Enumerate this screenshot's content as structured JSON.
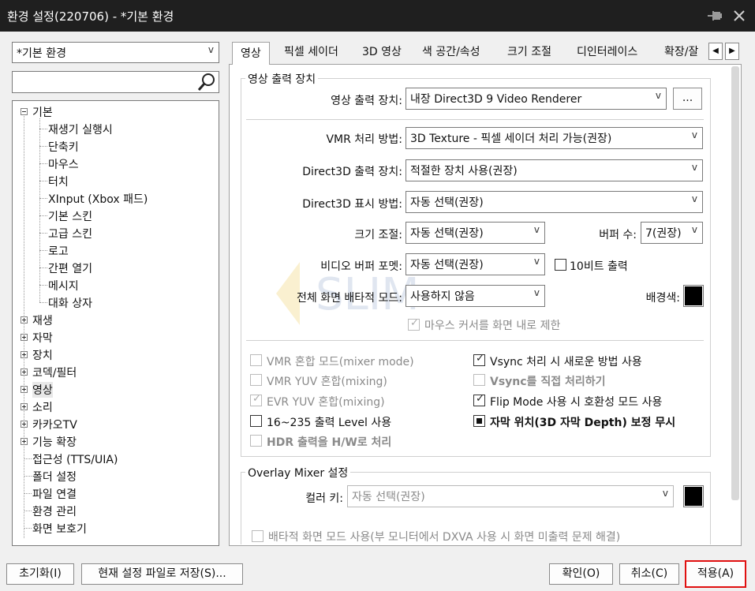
{
  "window": {
    "title": "환경 설정(220706) - *기본 환경"
  },
  "profile": {
    "selected": "*기본 환경"
  },
  "search": {
    "value": ""
  },
  "tree": {
    "expanded": {
      "label": "기본",
      "children": [
        "재생기 실행시",
        "단축키",
        "마우스",
        "터치",
        "XInput (Xbox 패드)",
        "기본 스킨",
        "고급 스킨",
        "로고",
        "간편 열기",
        "메시지",
        "대화 상자"
      ]
    },
    "collapsed": [
      "재생",
      "자막",
      "장치",
      "코덱/필터",
      "영상",
      "소리",
      "카카오TV",
      "기능 확장"
    ],
    "leaves": [
      "접근성 (TTS/UIA)",
      "폴더 설정",
      "파일 연결",
      "환경 관리",
      "화면 보호기"
    ]
  },
  "tabs": [
    "영상",
    "픽셀 세이더",
    "3D 영상",
    "색 공간/속성",
    "크기 조절",
    "디인터레이스",
    "확장/잘"
  ],
  "output_group": {
    "title": "영상 출력 장치",
    "device_label": "영상 출력 장치:",
    "device_value": "내장 Direct3D 9 Video Renderer",
    "browse_label": "...",
    "vmr_label": "VMR 처리 방법:",
    "vmr_value": "3D Texture - 픽셀 세이더 처리 가능(권장)",
    "d3d_device_label": "Direct3D 출력 장치:",
    "d3d_device_value": "적절한 장치 사용(권장)",
    "d3d_display_label": "Direct3D 표시 방법:",
    "d3d_display_value": "자동 선택(권장)",
    "size_label": "크기 조절:",
    "size_value": "자동 선택(권장)",
    "buffer_label": "버퍼 수:",
    "buffer_value": "7(권장)",
    "vbuf_label": "비디오 버퍼 포멧:",
    "vbuf_value": "자동 선택(권장)",
    "tenbit_label": "10비트 출력",
    "fullscreen_label": "전체 화면 배타적 모드:",
    "fullscreen_value": "사용하지 않음",
    "bgcolor_label": "배경색:",
    "mouse_limit_label": "마우스 커서를 화면 내로 제한"
  },
  "options": {
    "vmr_mixer": "VMR 혼합 모드(mixer mode)",
    "vmr_yuv": "VMR YUV 혼합(mixing)",
    "evr_yuv": "EVR YUV 혼합(mixing)",
    "level": "16~235 출력 Level 사용",
    "hdr": "HDR 출력을 H/W로 처리",
    "vsync_new": "Vsync 처리 시 새로운 방법 사용",
    "vsync_direct": "Vsync를 직접 처리하기",
    "flip": "Flip Mode 사용 시 호환성 모드 사용",
    "depth": "자막 위치(3D 자막 Depth) 보정 무시"
  },
  "overlay_group": {
    "title": "Overlay Mixer 설정",
    "color_key_label": "컬러 키:",
    "color_key_value": "자동 선택(권장)",
    "exclusive_label": "배타적 화면 모드 사용(부 모니터에서 DXVA 사용 시 화면 미출력 문제 해결)"
  },
  "footer": {
    "reset": "초기화(I)",
    "save_as": "현재 설정 파일로 저장(S)...",
    "ok": "확인(O)",
    "cancel": "취소(C)",
    "apply": "적용(A)"
  },
  "colors": {
    "titlebar": "#1f1f1f",
    "highlight": "#e01010"
  }
}
